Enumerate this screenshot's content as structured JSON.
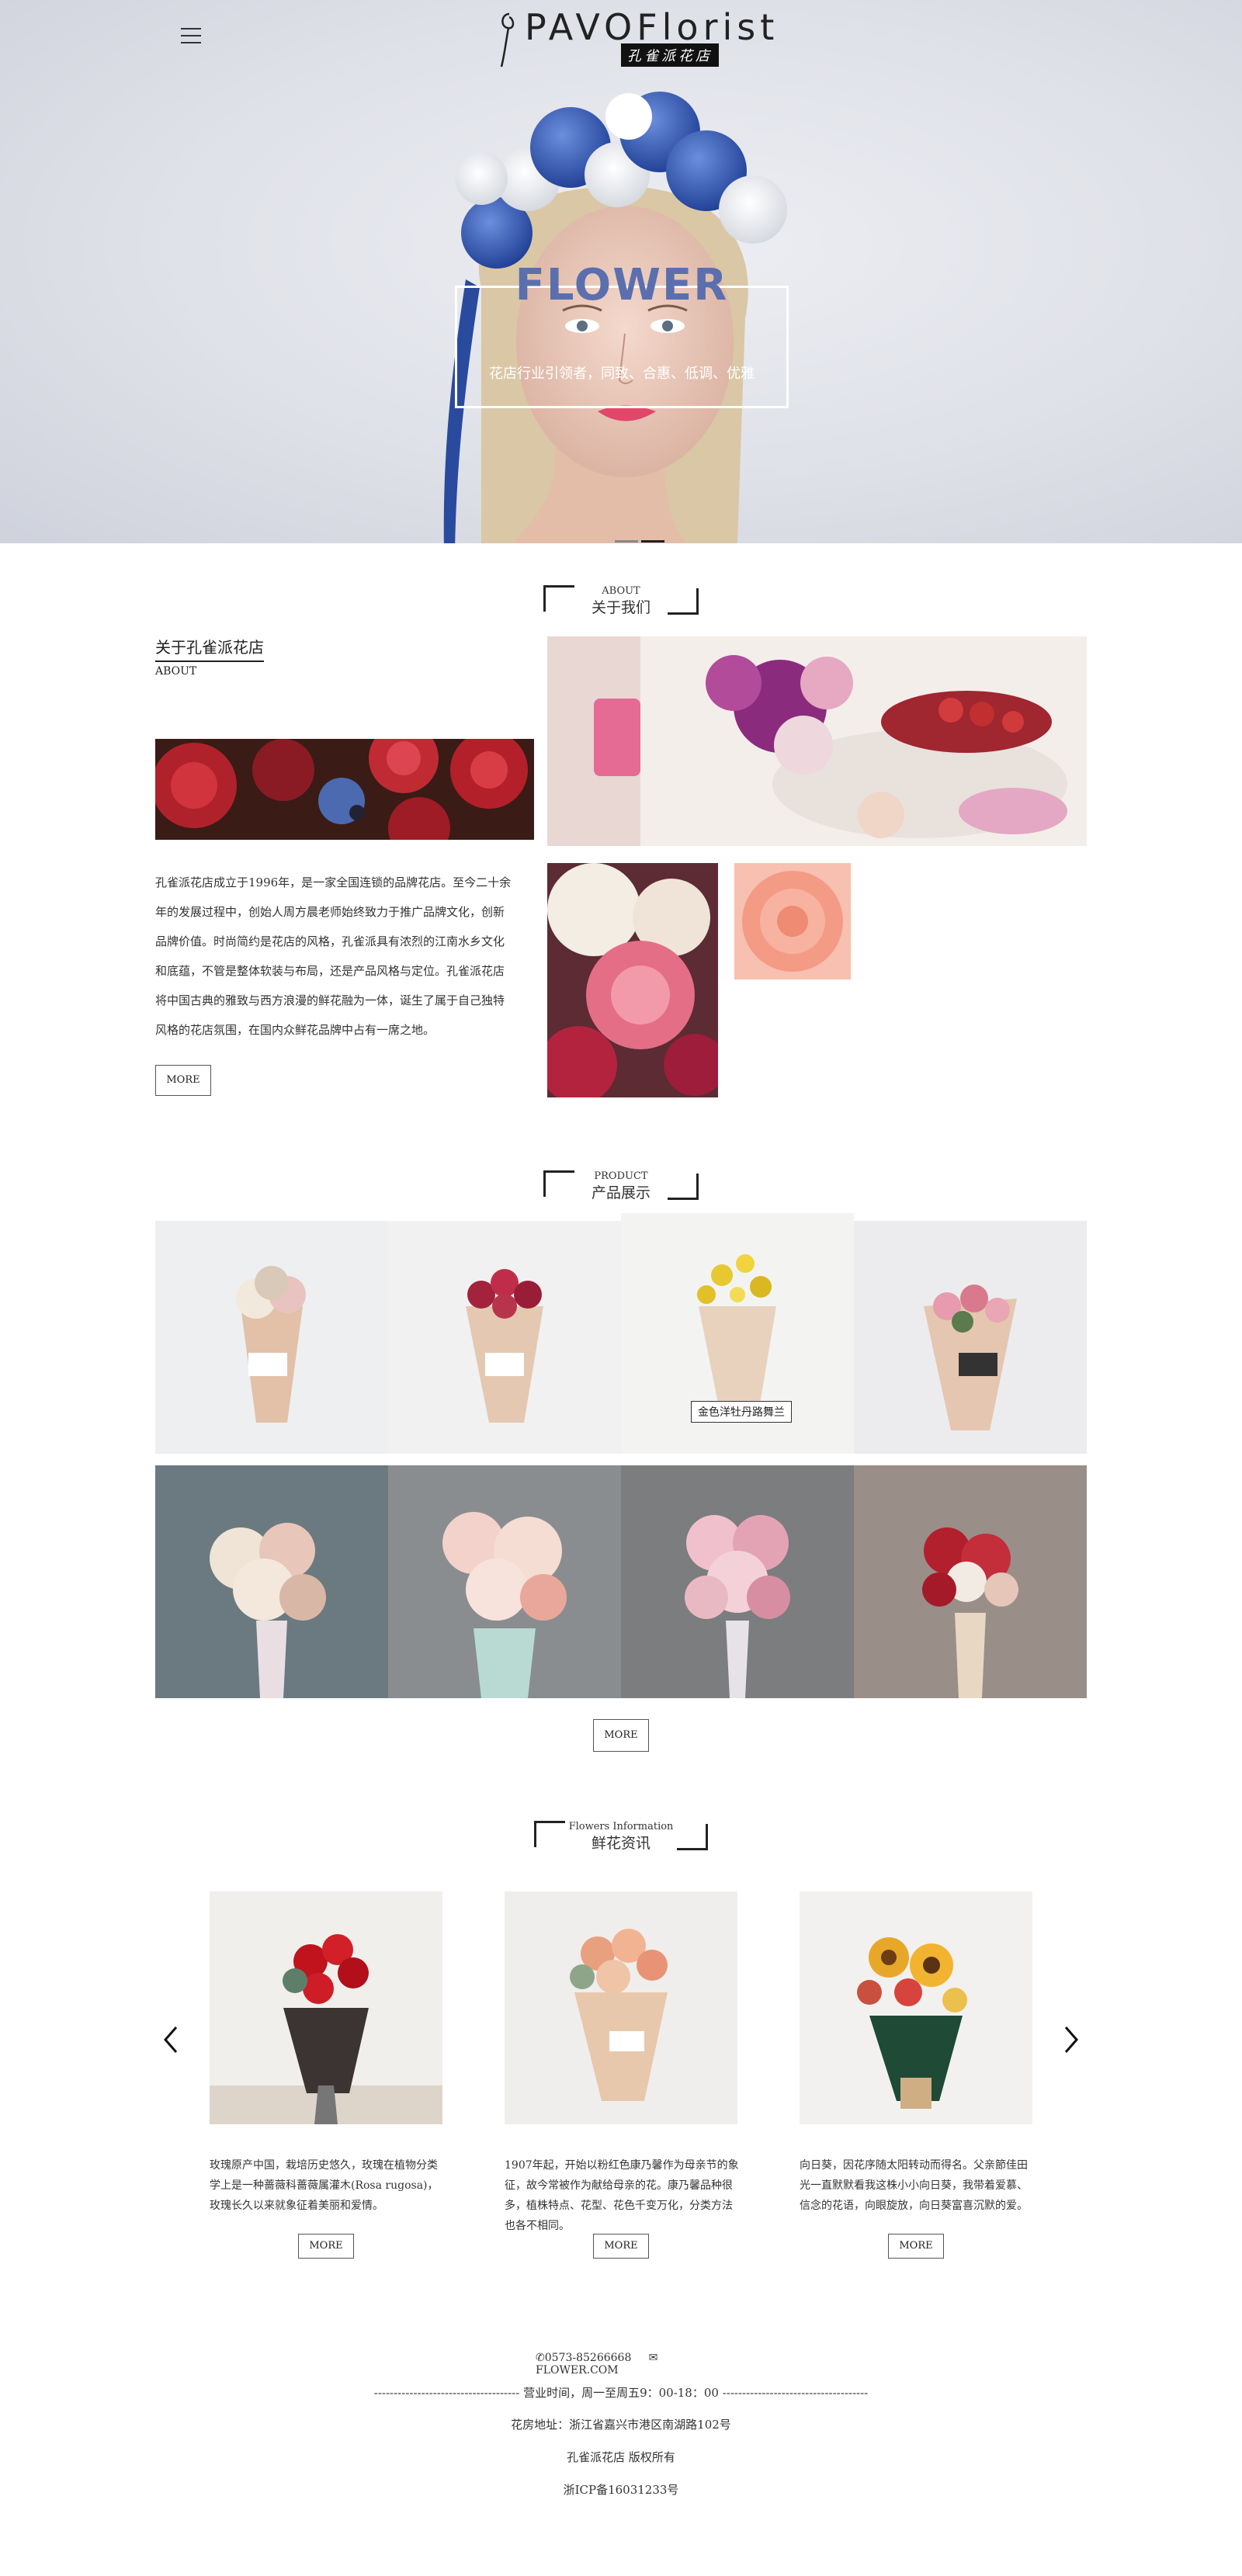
{
  "header": {
    "logo_text": "PAVOFlorist",
    "logo_sub": "孔雀派花店",
    "menu_icon": "hamburger-icon"
  },
  "hero": {
    "title": "FLOWER",
    "subtitle": "花店行业引领者，同致、合惠、低调、优雅",
    "slides": 2,
    "active_slide": 2
  },
  "about": {
    "section_en": "ABOUT",
    "section_cn": "关于我们",
    "heading_cn": "关于孔雀派花店",
    "heading_en": "ABOUT",
    "lines": [
      "孔雀派花店成立于1996年，是一家全国连锁的品牌花店。至今二十余",
      "年的发展过程中，创始人周方晨老师始终致力于推广品牌文化，创新",
      "品牌价值。时尚简约是花店的风格，孔雀派具有浓烈的江南水乡文化",
      "和底蕴，不管是整体软装与布局，还是产品风格与定位。孔雀派花店",
      "将中国古典的雅致与西方浪漫的鲜花融为一体，诞生了属于自己独特",
      "风格的花店氛围，在国内众鲜花品牌中占有一席之地。"
    ],
    "more_label": "MORE"
  },
  "products": {
    "section_en": "PRODUCT",
    "section_cn": "产品展示",
    "hover_caption": "金色洋牡丹路舞兰",
    "more_label": "MORE"
  },
  "news": {
    "section_en": "Flowers Information",
    "section_cn": "鲜花资讯",
    "items": [
      {
        "lines": [
          "玫瑰原产中国，栽培历史悠久，玫瑰在植物分类",
          "学上是一种蔷薇科蔷薇属灌木(Rosa rugosa)，",
          "玫瑰长久以来就象征着美丽和爱情。"
        ],
        "more": "MORE"
      },
      {
        "lines": [
          "1907年起，开始以粉红色康乃馨作为母亲节的象",
          "征，故今常被作为献给母亲的花。康乃馨品种很",
          "多，植株特点、花型、花色千变万化，分类方法",
          "也各不相同。"
        ],
        "more": "MORE"
      },
      {
        "lines": [
          "向日葵，因花序随太阳转动而得名。父亲節佳田",
          "光一直默默看我这株小小向日葵，我带着爱慕、",
          "信念的花语，向眼旋放，向日葵富喜沉默的爱。"
        ],
        "more": "MORE"
      }
    ],
    "prev_icon": "chevron-left-icon",
    "next_icon": "chevron-right-icon"
  },
  "footer": {
    "phone": "0573-85266668",
    "email": "FLOWER.COM",
    "hours": "------------------------------------- 营业时间，周一至周五9：00-18：00 -------------------------------------",
    "address": "花房地址：浙江省嘉兴市港区南湖路102号",
    "copyright": "孔雀派花店 版权所有",
    "icp": "浙ICP备16031233号"
  }
}
